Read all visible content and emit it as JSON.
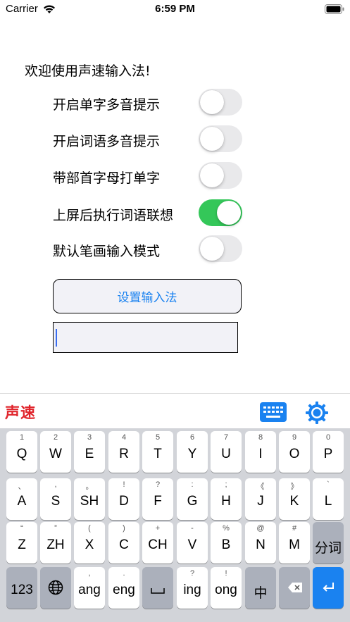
{
  "status": {
    "carrier": "Carrier",
    "time": "6:59 PM"
  },
  "welcome": "欢迎使用声速输入法!",
  "settings": [
    {
      "label": "开启单字多音提示",
      "on": false
    },
    {
      "label": "开启词语多音提示",
      "on": false
    },
    {
      "label": "带部首字母打单字",
      "on": false
    },
    {
      "label": "上屏后执行词语联想",
      "on": true
    },
    {
      "label": "默认笔画输入模式",
      "on": false
    }
  ],
  "setup_button": "设置输入法",
  "text_input": {
    "value": ""
  },
  "keyboard": {
    "brand": "声速",
    "row1": [
      {
        "hint": "1",
        "label": "Q"
      },
      {
        "hint": "2",
        "label": "W"
      },
      {
        "hint": "3",
        "label": "E"
      },
      {
        "hint": "4",
        "label": "R"
      },
      {
        "hint": "5",
        "label": "T"
      },
      {
        "hint": "6",
        "label": "Y"
      },
      {
        "hint": "7",
        "label": "U"
      },
      {
        "hint": "8",
        "label": "I"
      },
      {
        "hint": "9",
        "label": "O"
      },
      {
        "hint": "0",
        "label": "P"
      }
    ],
    "row2": [
      {
        "hint": "、",
        "label": "A"
      },
      {
        "hint": ",",
        "label": "S"
      },
      {
        "hint": "。",
        "label": "SH"
      },
      {
        "hint": "!",
        "label": "D"
      },
      {
        "hint": "?",
        "label": "F"
      },
      {
        "hint": ":",
        "label": "G"
      },
      {
        "hint": ";",
        "label": "H"
      },
      {
        "hint": "《",
        "label": "J"
      },
      {
        "hint": "》",
        "label": "K"
      },
      {
        "hint": "`",
        "label": "L"
      }
    ],
    "row3": [
      {
        "hint": "“",
        "label": "Z"
      },
      {
        "hint": "”",
        "label": "ZH"
      },
      {
        "hint": "(",
        "label": "X"
      },
      {
        "hint": ")",
        "label": "C"
      },
      {
        "hint": "+",
        "label": "CH"
      },
      {
        "hint": "-",
        "label": "V"
      },
      {
        "hint": "%",
        "label": "B"
      },
      {
        "hint": "@",
        "label": "N"
      },
      {
        "hint": "#",
        "label": "M"
      }
    ],
    "fenci": "分词",
    "row4": {
      "num": "123",
      "ang_hint": ",",
      "ang": "ang",
      "eng_hint": ".",
      "eng": "eng",
      "ing_hint": "?",
      "ing": "ing",
      "ong_hint": "!",
      "ong": "ong",
      "zhong": "中"
    }
  },
  "colors": {
    "accent": "#1a82f0",
    "toggle_on": "#34c759",
    "brand": "#e0242b"
  }
}
